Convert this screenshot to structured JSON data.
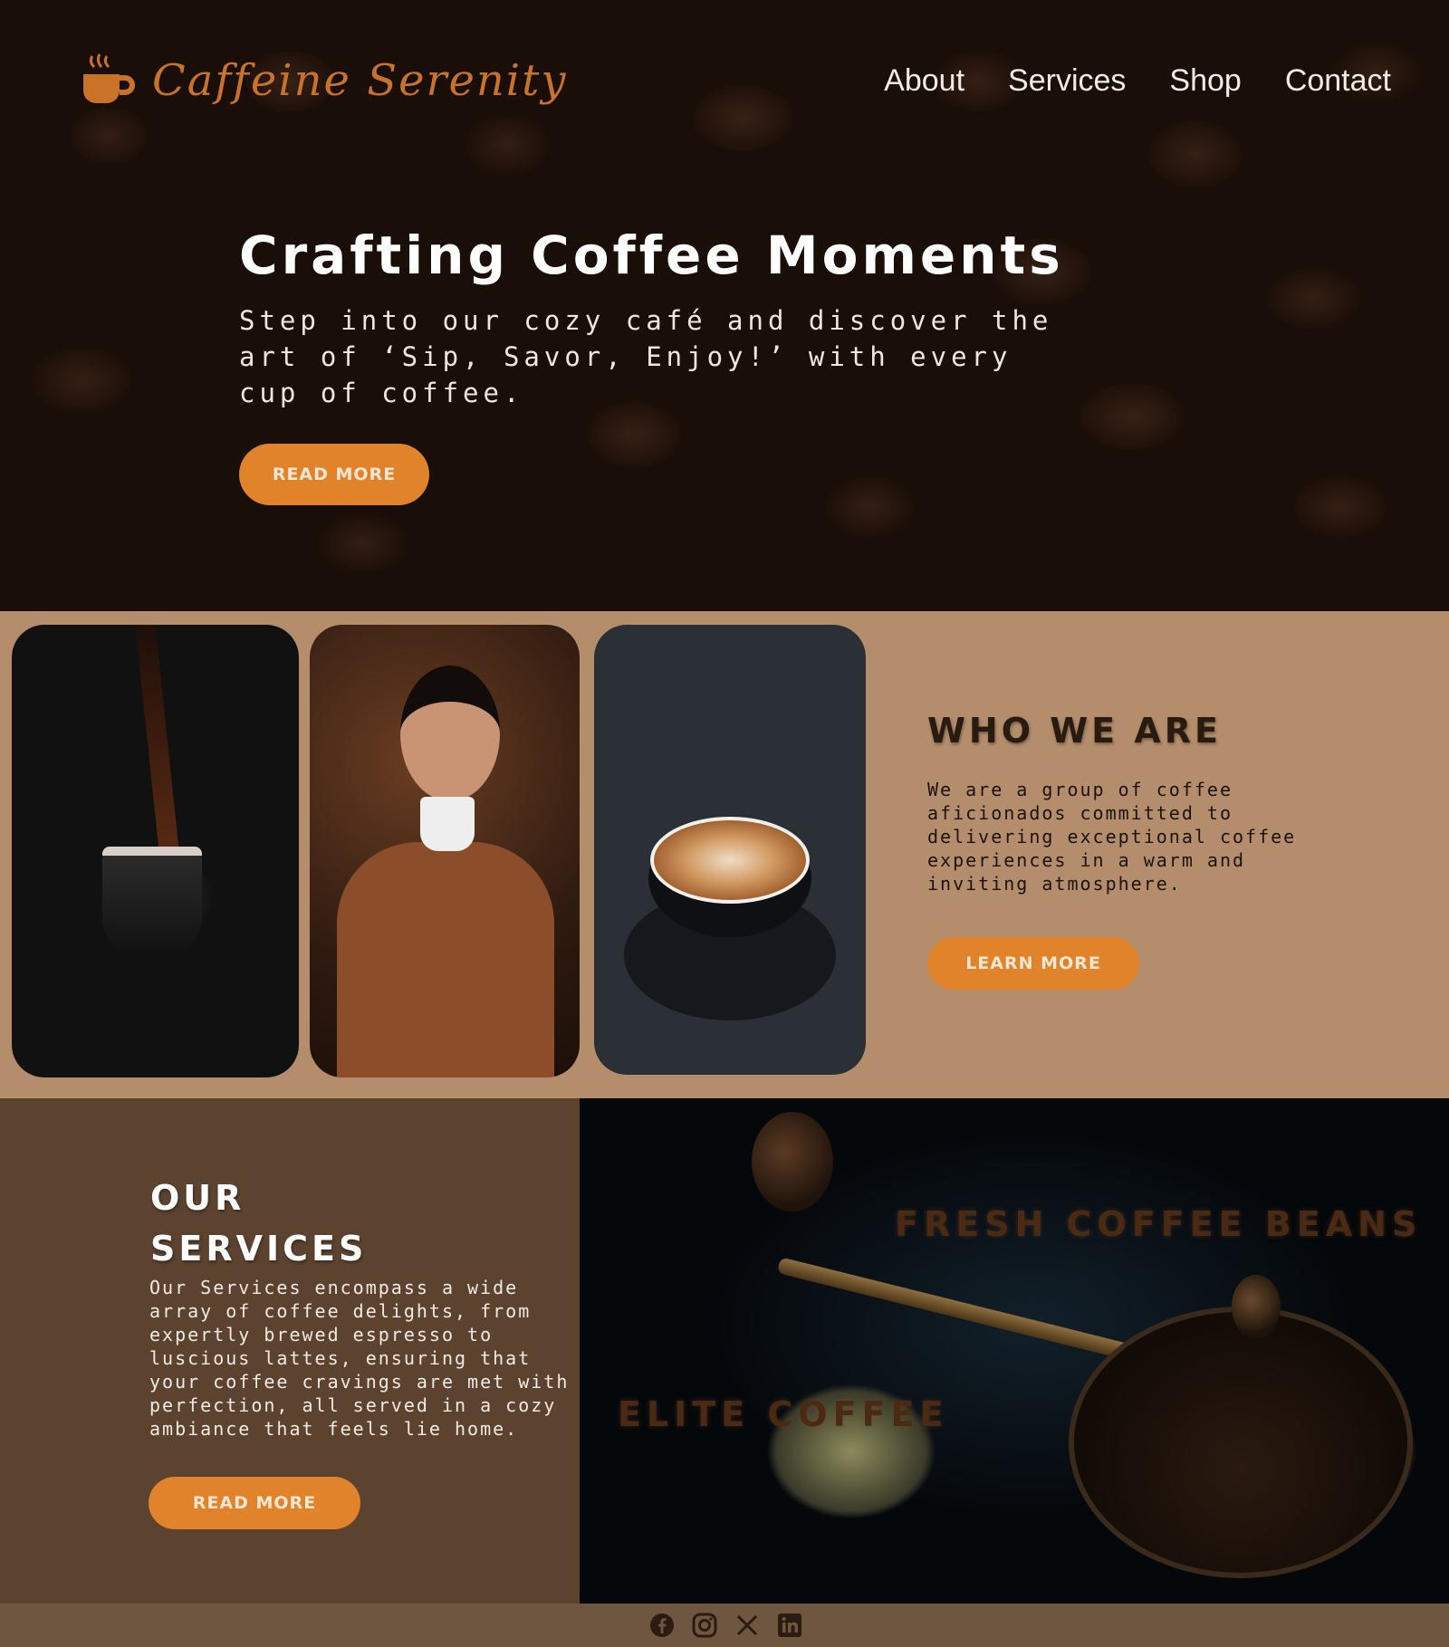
{
  "brand": {
    "name": "Caffeine Serenity",
    "logo_icon": "coffee-cup-icon",
    "color": "#c8722a"
  },
  "nav": {
    "items": [
      "About",
      "Services",
      "Shop",
      "Contact"
    ]
  },
  "hero": {
    "title": "Crafting Coffee Moments",
    "subtitle": "Step into our cozy café and discover the art of ‘Sip, Savor, Enjoy!’ with every cup of coffee.",
    "button": "READ MORE"
  },
  "who": {
    "title": "WHO WE ARE",
    "body": "We are a group of coffee aficionados committed to delivering exceptional coffee experiences in a warm and inviting atmosphere.",
    "button": "LEARN MORE"
  },
  "services": {
    "title": "OUR SERVICES",
    "body": "Our Services encompass a wide array of coffee delights, from expertly brewed espresso to luscious lattes, ensuring that your coffee cravings are met with perfection, all served in a cozy ambiance that feels lie home.",
    "button": "READ MORE",
    "overlay_1": "FRESH COFFEE BEANS",
    "overlay_2": "ELITE COFFEE"
  },
  "footer": {
    "social": [
      "facebook-icon",
      "instagram-icon",
      "x-icon",
      "linkedin-icon"
    ]
  },
  "colors": {
    "accent": "#e0832a",
    "who_bg": "#b48e6c",
    "services_bg": "#5c4330",
    "footer_bg": "#6e5640"
  }
}
